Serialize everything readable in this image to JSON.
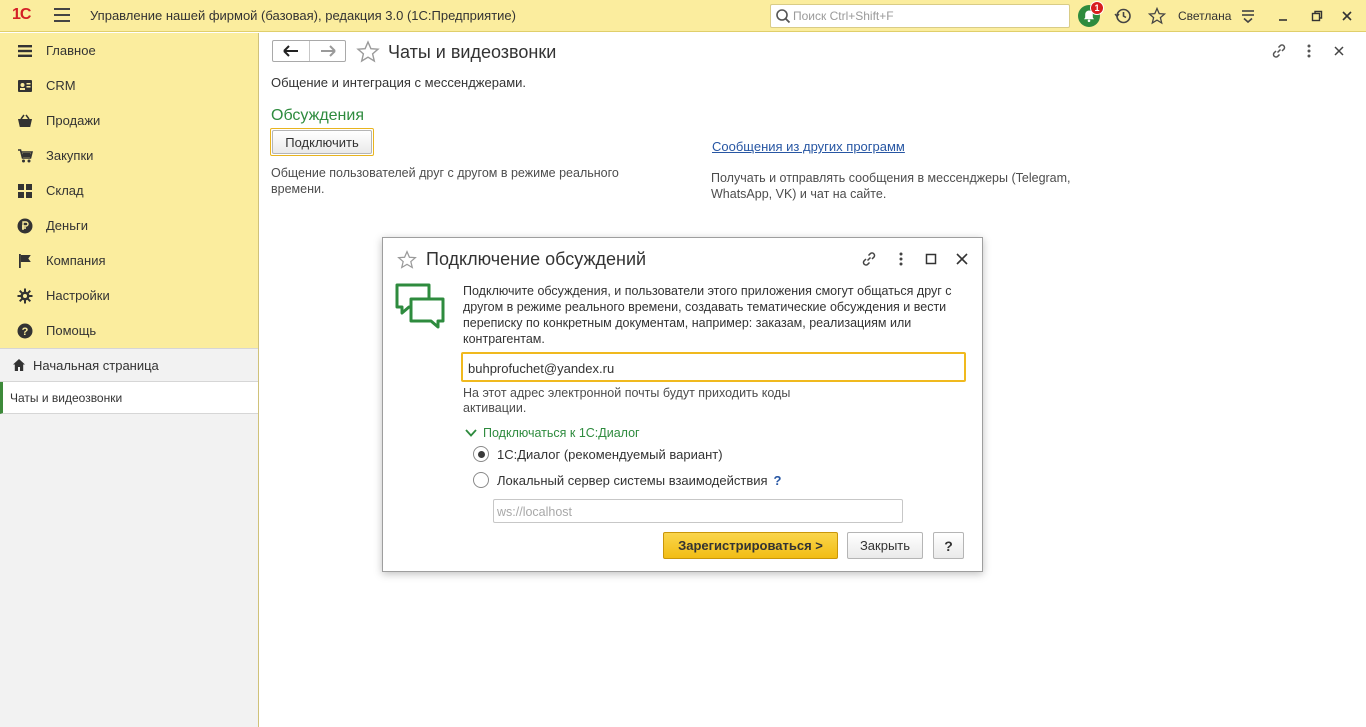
{
  "app": {
    "logo": "1С",
    "title": "Управление нашей фирмой (базовая), редакция 3.0  (1С:Предприятие)",
    "search_placeholder": "Поиск Ctrl+Shift+F",
    "notification_count": "1",
    "user": "Светлана",
    "icons": [
      "menu-icon",
      "search-icon",
      "bell-icon",
      "history-icon",
      "star-icon",
      "settings-icon",
      "restore-window-icon",
      "close-icon"
    ]
  },
  "sidebar": {
    "items": [
      {
        "label": "Главное",
        "icon": "menu-lines-icon"
      },
      {
        "label": "CRM",
        "icon": "contacts-icon"
      },
      {
        "label": "Продажи",
        "icon": "basket-icon"
      },
      {
        "label": "Закупки",
        "icon": "cart-icon"
      },
      {
        "label": "Склад",
        "icon": "grid-icon"
      },
      {
        "label": "Деньги",
        "icon": "ruble-icon"
      },
      {
        "label": "Компания",
        "icon": "flag-icon"
      },
      {
        "label": "Настройки",
        "icon": "gear-icon"
      },
      {
        "label": "Помощь",
        "icon": "help-icon"
      }
    ],
    "home": "Начальная страница",
    "open_tabs": [
      "Чаты и видеозвонки"
    ]
  },
  "page": {
    "title": "Чаты и видеозвонки",
    "description": "Общение и интеграция с мессенджерами.",
    "section_title": "Обсуждения",
    "connect_button": "Подключить",
    "connect_description": "Общение пользователей друг с другом в режиме реального времени.",
    "other_link": "Сообщения из других программ",
    "other_description": "Получать и отправлять сообщения в мессенджеры (Telegram, WhatsApp, VK) и чат на сайте."
  },
  "dialog": {
    "title": "Подключение обсуждений",
    "intro": "Подключите обсуждения, и пользователи этого приложения смогут общаться друг с другом в режиме реального времени, создавать тематические обсуждения и вести переписку по конкретным документам, например: заказам, реализациям или контрагентам.",
    "email_value": "buhprofuchet@yandex.ru",
    "email_hint": "На этот адрес электронной почты будут приходить коды активации.",
    "group_label": "Подключаться к 1С:Диалог",
    "option_dialog": "1С:Диалог (рекомендуемый вариант)",
    "option_local": "Локальный сервер системы взаимодействия",
    "help_mark": "?",
    "ws_placeholder": "ws://localhost",
    "register_button": "Зарегистрироваться >",
    "close_button": "Закрыть",
    "help_button": "?"
  },
  "colors": {
    "accent_yellow": "#fbed9e",
    "brand_green": "#2e8b3e",
    "link_blue": "#2756a3",
    "logo_red": "#d31f26"
  }
}
